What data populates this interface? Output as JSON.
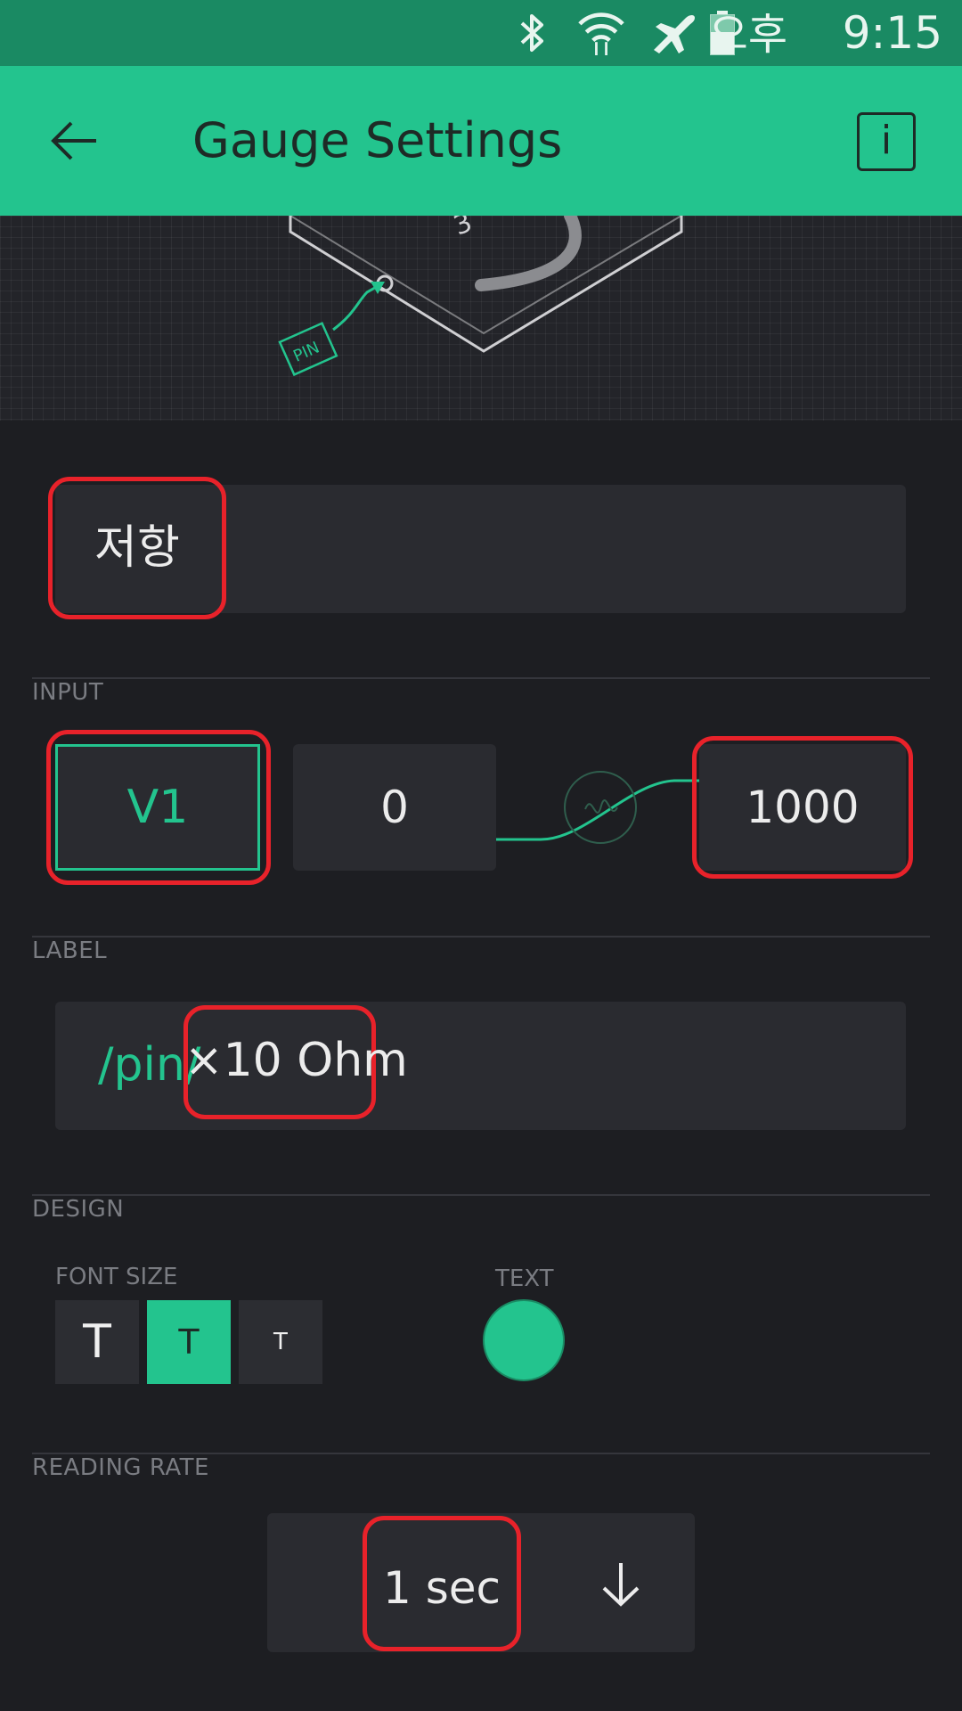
{
  "status_bar": {
    "ampm": "오후",
    "time": "9:15",
    "icons": [
      "bluetooth-icon",
      "wifi-icon",
      "airplane-icon",
      "battery-icon"
    ]
  },
  "app_bar": {
    "title": "Gauge Settings",
    "back_icon": "arrow-left-icon",
    "info_label": "i"
  },
  "illustration": {
    "pin_tag": "PIN",
    "dial_digit": "3"
  },
  "widget_name": {
    "value": "저항"
  },
  "input": {
    "section_label": "INPUT",
    "pin": "V1",
    "min": "0",
    "max": "1000"
  },
  "label": {
    "section_label": "LABEL",
    "prefix": "/pin/",
    "suffix": "×10 Ohm"
  },
  "design": {
    "section_label": "DESIGN",
    "font_size_label": "FONT SIZE",
    "font_sizes": [
      {
        "label": "T",
        "active": false
      },
      {
        "label": "T",
        "active": true
      },
      {
        "label": "T",
        "active": false
      }
    ],
    "text_color_label": "TEXT",
    "text_color": "#23c48e"
  },
  "reading_rate": {
    "section_label": "READING RATE",
    "value": "1 sec",
    "dropdown_icon": "arrow-down-icon"
  },
  "colors": {
    "accent": "#23c48e",
    "status_bar": "#1a8a63",
    "background": "#1d1e22",
    "highlight": "#e8222a"
  }
}
